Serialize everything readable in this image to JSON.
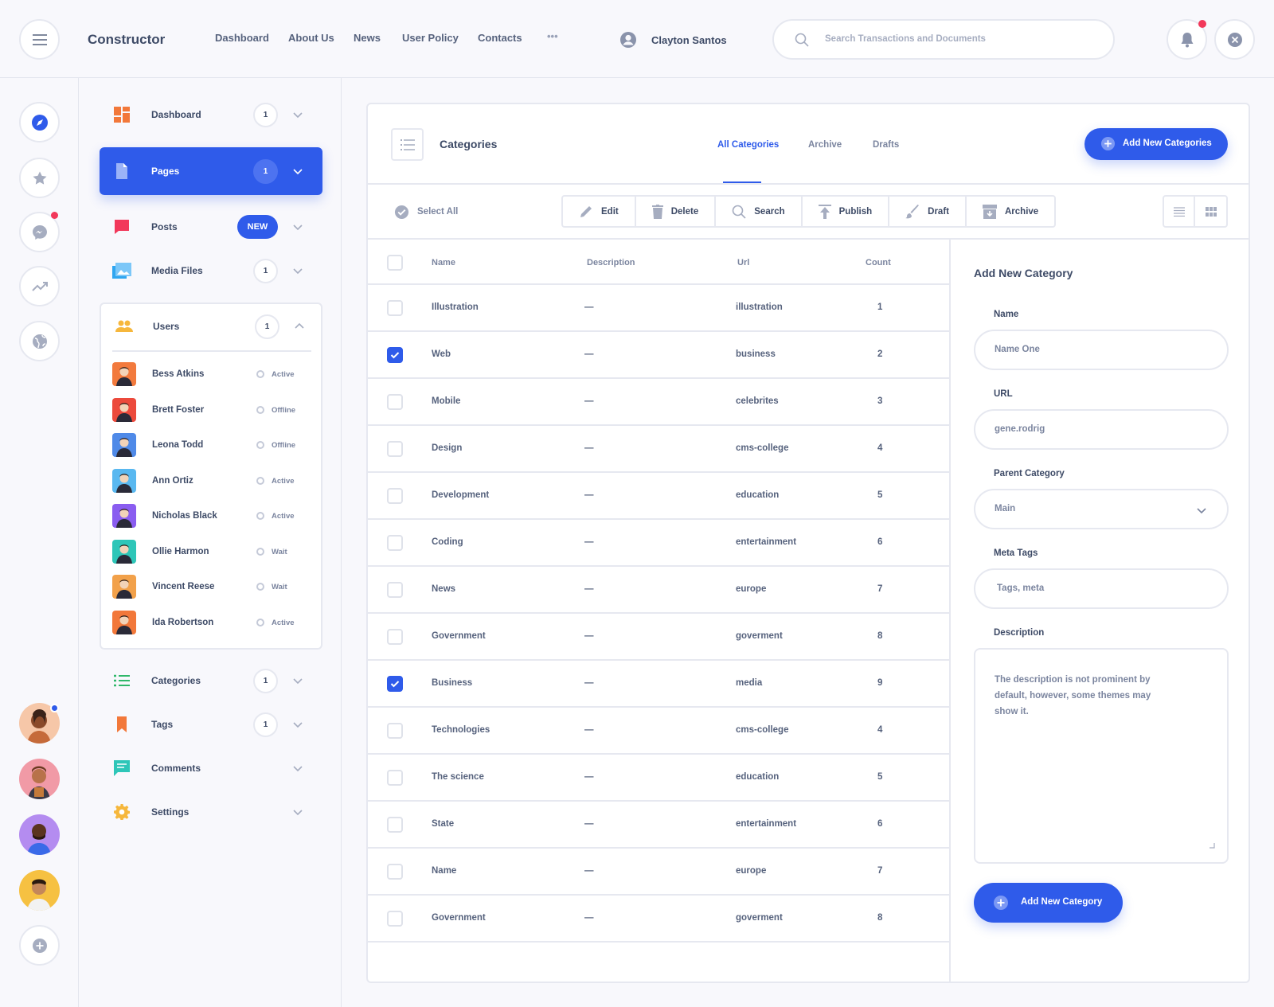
{
  "header": {
    "brand": "Constructor",
    "nav": [
      "Dashboard",
      "About Us",
      "News",
      "User Policy",
      "Contacts"
    ],
    "more_label": "•••",
    "user_name": "Clayton Santos",
    "search_placeholder": "Search Transactions and Documents"
  },
  "sidebar": {
    "dashboard": {
      "label": "Dashboard",
      "badge": "1"
    },
    "pages": {
      "label": "Pages",
      "badge": "1"
    },
    "posts": {
      "label": "Posts",
      "badge": "NEW"
    },
    "media": {
      "label": "Media Files",
      "badge": "1"
    },
    "users": {
      "label": "Users",
      "badge": "1"
    },
    "categories": {
      "label": "Categories",
      "badge": "1"
    },
    "tags": {
      "label": "Tags",
      "badge": "1"
    },
    "comments": {
      "label": "Comments"
    },
    "settings": {
      "label": "Settings"
    }
  },
  "users": [
    {
      "name": "Bess Atkins",
      "status": "Active",
      "color": "#f27a3d"
    },
    {
      "name": "Brett Foster",
      "status": "Offline",
      "color": "#ec4a3c"
    },
    {
      "name": "Leona Todd",
      "status": "Offline",
      "color": "#4f8ae8"
    },
    {
      "name": "Ann Ortiz",
      "status": "Active",
      "color": "#59b8f0"
    },
    {
      "name": "Nicholas Black",
      "status": "Active",
      "color": "#8a5df0"
    },
    {
      "name": "Ollie Harmon",
      "status": "Wait",
      "color": "#2ec6b8"
    },
    {
      "name": "Vincent Reese",
      "status": "Wait",
      "color": "#f2a14a"
    },
    {
      "name": "Ida Robertson",
      "status": "Active",
      "color": "#f2783a"
    }
  ],
  "categories": {
    "title": "Categories",
    "tabs": [
      "All Categories",
      "Archive",
      "Drafts"
    ],
    "add_button": "Add New Categories",
    "select_all": "Select All",
    "toolbar": [
      "Edit",
      "Delete",
      "Search",
      "Publish",
      "Draft",
      "Archive"
    ],
    "columns": [
      "Name",
      "Description",
      "Url",
      "Count"
    ],
    "rows": [
      {
        "name": "Illustration",
        "desc": "—",
        "url": "illustration",
        "count": "1",
        "checked": false
      },
      {
        "name": "Web",
        "desc": "—",
        "url": "business",
        "count": "2",
        "checked": true
      },
      {
        "name": "Mobile",
        "desc": "—",
        "url": "celebrites",
        "count": "3",
        "checked": false
      },
      {
        "name": "Design",
        "desc": "—",
        "url": "cms-college",
        "count": "4",
        "checked": false
      },
      {
        "name": "Development",
        "desc": "—",
        "url": "education",
        "count": "5",
        "checked": false
      },
      {
        "name": "Coding",
        "desc": "—",
        "url": "entertainment",
        "count": "6",
        "checked": false
      },
      {
        "name": "News",
        "desc": "—",
        "url": "europe",
        "count": "7",
        "checked": false
      },
      {
        "name": "Government",
        "desc": "—",
        "url": "goverment",
        "count": "8",
        "checked": false
      },
      {
        "name": "Business",
        "desc": "—",
        "url": "media",
        "count": "9",
        "checked": true
      },
      {
        "name": "Technologies",
        "desc": "—",
        "url": "cms-college",
        "count": "4",
        "checked": false
      },
      {
        "name": "The science",
        "desc": "—",
        "url": "education",
        "count": "5",
        "checked": false
      },
      {
        "name": "State",
        "desc": "—",
        "url": "entertainment",
        "count": "6",
        "checked": false
      },
      {
        "name": "Name",
        "desc": "—",
        "url": "europe",
        "count": "7",
        "checked": false
      },
      {
        "name": "Government",
        "desc": "—",
        "url": "goverment",
        "count": "8",
        "checked": false
      }
    ]
  },
  "form": {
    "title": "Add New Category",
    "name_label": "Name",
    "name_value": "Name One",
    "url_label": "URL",
    "url_value": "gene.rodrig",
    "parent_label": "Parent Category",
    "parent_value": "Main",
    "meta_label": "Meta Tags",
    "meta_value": "Tags, meta",
    "desc_label": "Description",
    "desc_value": "The description is not prominent by default, however, some themes may show it.",
    "submit": "Add New Category"
  },
  "colors": {
    "accent": "#2f5bea",
    "alert": "#f2385a"
  }
}
